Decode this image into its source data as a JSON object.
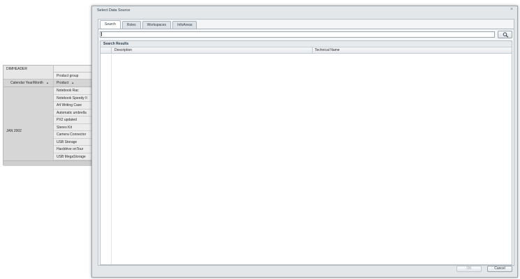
{
  "background_table": {
    "dimheader": "DIMHEADER",
    "product_group_label": "Product group",
    "calendar_header": "Calendar Year/Month",
    "product_header": "Product",
    "month_value": "JAN 2002",
    "products": [
      "Notebook Rac",
      "Notebook Speedy II",
      "A4 Writing Case",
      "Automatic umbrella",
      "PX2 updated",
      "Stereo Kit",
      "Camera Connector",
      "USB Storage",
      "Harddrive onTour",
      "USB MegaStorage"
    ]
  },
  "dialog": {
    "title": "Select Data Source",
    "close_glyph": "×",
    "tabs": [
      "Search",
      "Roles",
      "Workspaces",
      "InfoAreas"
    ],
    "search": {
      "value": "",
      "placeholder": ""
    },
    "results_title": "Search Results",
    "columns": {
      "description": "Description",
      "technical_name": "Technical Name"
    },
    "ok_label": "OK",
    "cancel_label": "Cancel"
  },
  "icons": {
    "search_button": "magnifier-icon",
    "close": "close-icon",
    "sort": "sort-arrow-icon"
  }
}
